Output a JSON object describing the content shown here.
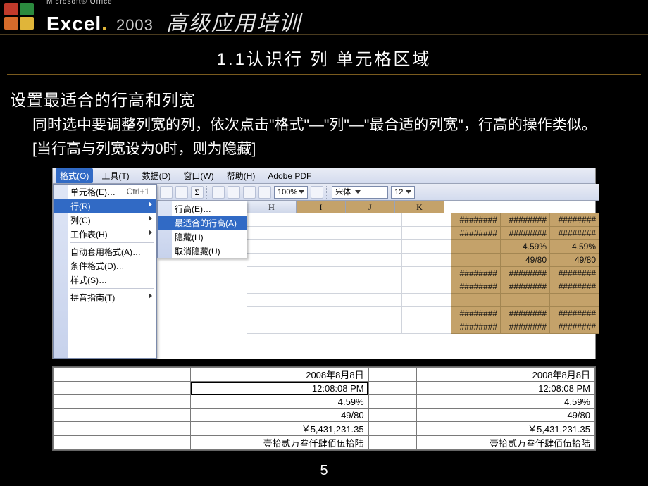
{
  "header": {
    "ms_office": "Microsoft® Office",
    "excel": "Excel",
    "year": "2003",
    "cn_title": "高级应用培训"
  },
  "slide": {
    "title": "1.1认识行 列 单元格区域",
    "heading": "设置最适合的行高和列宽",
    "paragraph": "同时选中要调整列宽的列，依次点击\"格式\"—\"列\"—\"最合适的列宽\"，行高的操作类似。[当行高与列宽设为0时，则为隐藏]"
  },
  "menubar": {
    "items": [
      "格式(O)",
      "工具(T)",
      "数据(D)",
      "窗口(W)",
      "帮助(H)",
      "Adobe PDF"
    ]
  },
  "toolbar": {
    "zoom": "100%",
    "font": "宋体",
    "size": "12"
  },
  "format_menu": {
    "items": [
      {
        "label": "单元格(E)…",
        "shortcut": "Ctrl+1",
        "arrow": false
      },
      {
        "label": "行(R)",
        "arrow": true,
        "highlight": true
      },
      {
        "label": "列(C)",
        "arrow": true
      },
      {
        "label": "工作表(H)",
        "arrow": true
      },
      {
        "label": "自动套用格式(A)…",
        "arrow": false
      },
      {
        "label": "条件格式(D)…",
        "arrow": false
      },
      {
        "label": "样式(S)…",
        "arrow": false
      },
      {
        "label": "拼音指南(T)",
        "arrow": true
      }
    ]
  },
  "sub_menu": {
    "items": [
      {
        "label": "行高(E)…",
        "highlight": false
      },
      {
        "label": "最适合的行高(A)",
        "highlight": true
      },
      {
        "label": "隐藏(H)",
        "highlight": false
      },
      {
        "label": "取消隐藏(U)",
        "highlight": false
      }
    ]
  },
  "sheet": {
    "col_head_spacer": "",
    "columns": [
      "H",
      "I",
      "J",
      "K"
    ],
    "selected_cols": [
      "I",
      "J",
      "K"
    ],
    "hash": "########",
    "rows_ijk": [
      [
        "########",
        "########",
        "########"
      ],
      [
        "########",
        "########",
        "########"
      ],
      [
        "",
        "4.59%",
        "4.59%"
      ],
      [
        "",
        "49/80",
        "49/80"
      ],
      [
        "########",
        "########",
        "########"
      ],
      [
        "########",
        "########",
        "########"
      ],
      [
        "",
        "",
        ""
      ],
      [
        "########",
        "########",
        "########"
      ],
      [
        "########",
        "########",
        "########"
      ]
    ]
  },
  "wide_table": {
    "rows": [
      [
        "2008年8月8日",
        "2008年8月8日"
      ],
      [
        "12:08:08 PM",
        "12:08:08 PM"
      ],
      [
        "4.59%",
        "4.59%"
      ],
      [
        "49/80",
        "49/80"
      ],
      [
        "￥5,431,231.35",
        "￥5,431,231.35"
      ],
      [
        "壹拾贰万叁仟肆佰伍拾陆",
        "壹拾贰万叁仟肆佰伍拾陆"
      ]
    ],
    "active_row_index": 1
  },
  "page_number": "5"
}
